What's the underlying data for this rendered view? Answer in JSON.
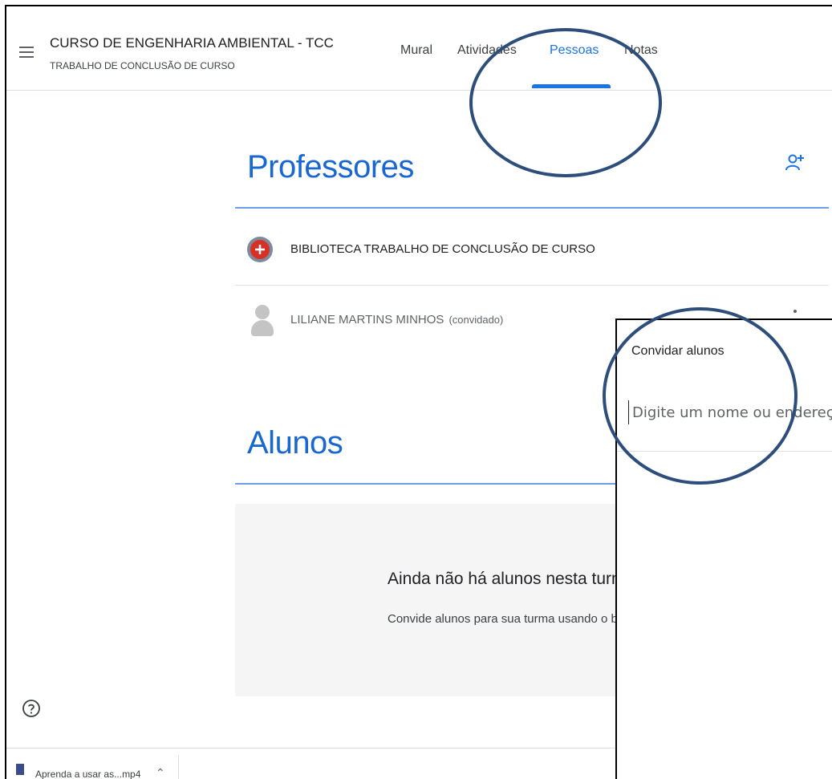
{
  "header": {
    "title": "CURSO DE ENGENHARIA AMBIENTAL - TCC",
    "subtitle": "TRABALHO DE CONCLUSÃO DE CURSO",
    "tabs": [
      {
        "label": "Mural"
      },
      {
        "label": "Atividades"
      },
      {
        "label": "Pessoas",
        "active": true
      },
      {
        "label": "Notas"
      }
    ]
  },
  "teachers": {
    "title": "Professores",
    "people": [
      {
        "name": "BIBLIOTECA TRABALHO DE CONCLUSÃO DE CURSO"
      },
      {
        "name": "LILIANE MARTINS MINHOS",
        "tag": "(convidado)"
      }
    ]
  },
  "students": {
    "title": "Alunos",
    "empty_title": "Ainda não há alunos nesta turma",
    "empty_desc": "Convide alunos para sua turma usando o bo"
  },
  "invite_dialog": {
    "title": "Convidar alunos",
    "placeholder": "Digite um nome ou endereço"
  },
  "download_bar": {
    "file_label": "Aprenda a usar as...mp4"
  },
  "colors": {
    "accent": "#1a73e8",
    "annotation": "#2d4d7a"
  }
}
